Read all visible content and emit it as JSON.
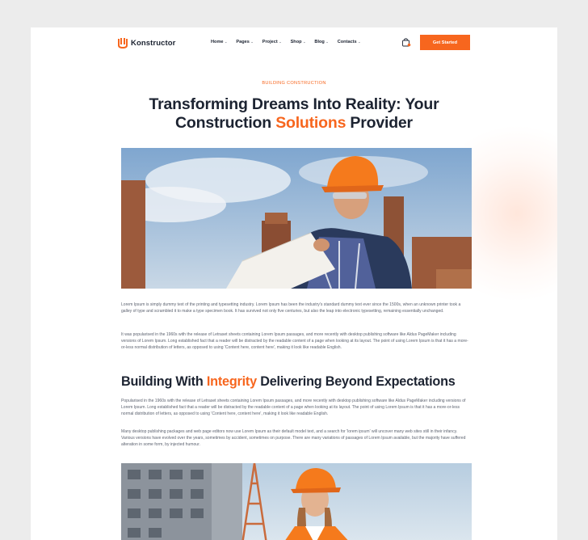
{
  "brand": {
    "name": "Konstructor",
    "accent_color": "#f7661e",
    "text_color": "#1c2331"
  },
  "nav": {
    "items": [
      {
        "label": "Home",
        "icon": "chevron-down-icon"
      },
      {
        "label": "Pages",
        "icon": "chevron-down-icon"
      },
      {
        "label": "Project",
        "icon": "chevron-down-icon"
      },
      {
        "label": "Shop",
        "icon": "chevron-down-icon"
      },
      {
        "label": "Blog",
        "icon": "chevron-down-icon"
      },
      {
        "label": "Contacts",
        "icon": "chevron-down-icon"
      }
    ],
    "cart_icon": "shopping-bag-icon",
    "cta_label": "Get Started"
  },
  "hero": {
    "eyebrow": "BUILDING CONSTRUCTION",
    "title_part1": "Transforming Dreams Into Reality: Your Construction ",
    "title_accent": "Solutions",
    "title_part2": " Provider"
  },
  "content": {
    "paragraph1": "Lorem Ipsum is simply dummy text of the printing and typesetting industry. Lorem Ipsum has been the industry's standard dummy text ever since the 1500s, when an unknown printer took a galley of type and scrambled it to make a type specimen book. It has survived not only five centuries, but also the leap into electronic typesetting, remaining essentially unchanged.",
    "paragraph2": "It was popularised in the 1960s with the release of Letraset sheets containing Lorem Ipsum passages, and more recently with desktop publishing software like Aldus PageMaker including versions of Lorem Ipsum. Long established fact that a reader will be distracted by the readable content of a page when looking at its layout. The point of using Lorem Ipsum is that it has a more-or-less normal distribution of letters, as opposed to using 'Content here, content here', making it look like readable English.",
    "heading_part1": "Building With ",
    "heading_accent": "Integrity",
    "heading_part2": " Delivering Beyond Expectations",
    "paragraph3": "Popularised in the 1960s with the release of Letraset sheets containing Lorem Ipsum passages, and more recently with desktop publishing software like Aldus PageMaker including versions of Lorem Ipsum. Long established fact that a reader will be distracted by the readable content of a page when looking at its layout. The point of using Lorem Ipsum is that it has a more-or-less normal distribution of letters, as opposed to using 'Content here, content here', making it look like readable English.",
    "paragraph4": "Many desktop publishing packages and web page editors now use Lorem Ipsum as their default model text, and a search for 'lorem ipsum' will uncover many web sites still in their infancy. Various versions have evolved over the years, sometimes by accident, sometimes on purpose. There are many variations of passages of Lorem Ipsum available, but the majority have suffered alteration in some form, by injected humour."
  }
}
